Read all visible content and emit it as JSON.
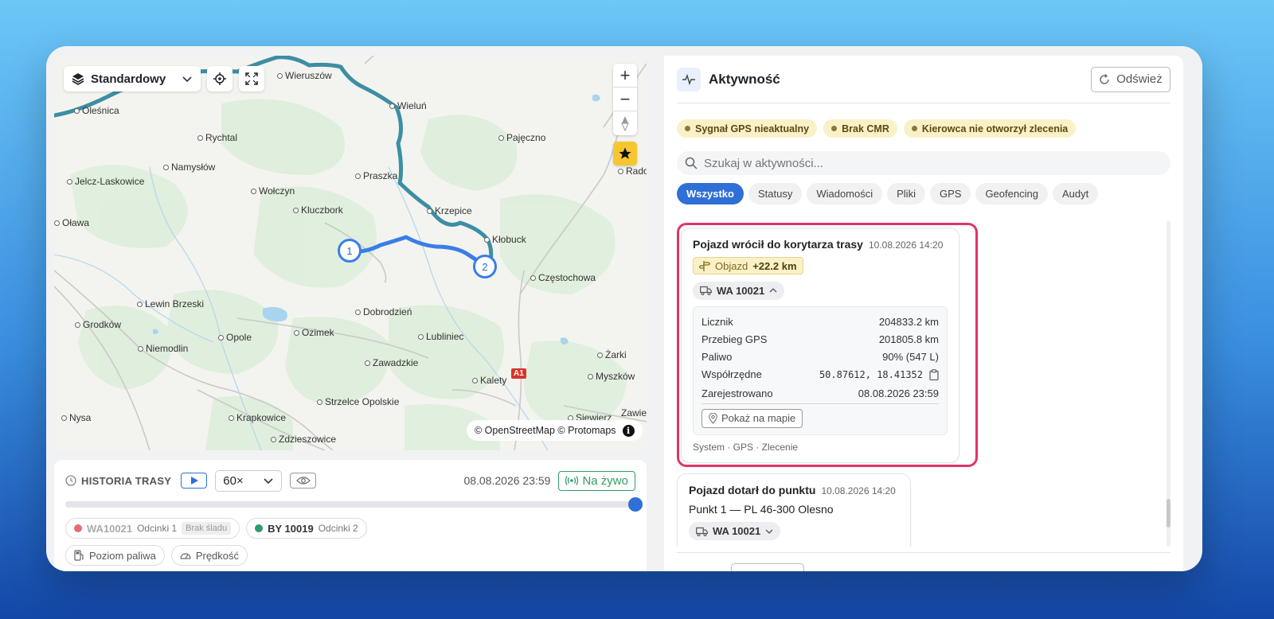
{
  "map": {
    "layer_label": "Standardowy",
    "attribution": "© OpenStreetMap © Protomaps",
    "info_glyph": "i",
    "zoom_in": "+",
    "zoom_out": "−",
    "road_badge": "A1",
    "markers": [
      "1",
      "2"
    ],
    "towns": [
      {
        "name": "Oleśnica"
      },
      {
        "name": "Wieruszów"
      },
      {
        "name": "Wieluń"
      },
      {
        "name": "Pajęczno"
      },
      {
        "name": "Rychtal"
      },
      {
        "name": "Namysłów"
      },
      {
        "name": "Praszka"
      },
      {
        "name": "Rado"
      },
      {
        "name": "Jelcz-Laskowice"
      },
      {
        "name": "Wołczyn"
      },
      {
        "name": "Krzepice"
      },
      {
        "name": "Kluczbork"
      },
      {
        "name": "Oława"
      },
      {
        "name": "Kłobuck"
      },
      {
        "name": "Częstochowa"
      },
      {
        "name": "Lewin Brzeski"
      },
      {
        "name": "Dobrodzień"
      },
      {
        "name": "Grodków"
      },
      {
        "name": "Ozimek"
      },
      {
        "name": "Lubliniec"
      },
      {
        "name": "Opole"
      },
      {
        "name": "Niemodlin"
      },
      {
        "name": "Żarki"
      },
      {
        "name": "Zawadzkie"
      },
      {
        "name": "Myszków"
      },
      {
        "name": "Kalety"
      },
      {
        "name": "Strzelce Opolskie"
      },
      {
        "name": "Nysa"
      },
      {
        "name": "Krapkowice"
      },
      {
        "name": "Zawie"
      },
      {
        "name": "Zdzieszowice"
      },
      {
        "name": "Siewierz"
      }
    ]
  },
  "history": {
    "title": "HISTORIA TRASY",
    "speed": "60×",
    "timestamp": "08.08.2026 23:59",
    "live_label": "Na żywo",
    "progress": 1.0,
    "vehicles": [
      {
        "name": "WA10021",
        "segments": "Odcinki 1",
        "note": "Brak śladu",
        "color": "#e26d72"
      },
      {
        "name": "BY 10019",
        "segments": "Odcinki 2",
        "color": "#2e9b6a"
      }
    ],
    "layers": [
      "Poziom paliwa",
      "Prędkość"
    ]
  },
  "activity": {
    "title": "Aktywność",
    "refresh_label": "Odśwież",
    "alerts": [
      "Sygnał GPS nieaktualny",
      "Brak CMR",
      "Kierowca nie otworzył zlecenia"
    ],
    "search_placeholder": "Szukaj w aktywności...",
    "tabs": [
      "Wszystko",
      "Statusy",
      "Wiadomości",
      "Pliki",
      "GPS",
      "Geofencing",
      "Audyt"
    ],
    "active_tab": "Wszystko",
    "events": [
      {
        "title": "Pojazd wrócił do korytarza trasy",
        "time": "10.08.2026 14:20",
        "detour_label": "Objazd",
        "detour_value": "+22.2 km",
        "vehicle": "WA 10021",
        "details": [
          {
            "label": "Licznik",
            "value": "204833.2 km"
          },
          {
            "label": "Przebieg GPS",
            "value": "201805.8 km"
          },
          {
            "label": "Paliwo",
            "value": "90% (547 L)"
          },
          {
            "label": "Współrzędne",
            "value": "50.87612, 18.41352"
          },
          {
            "label": "Zarejestrowano",
            "value": "08.08.2026 23:59"
          }
        ],
        "map_button": "Pokaż na mapie",
        "footer": "System · GPS · Zlecenie"
      },
      {
        "title": "Pojazd dotarł do punktu",
        "time": "10.08.2026 14:20",
        "line": "Punkt 1 — PL 46-300 Olesno",
        "vehicle": "WA 10021"
      }
    ]
  }
}
